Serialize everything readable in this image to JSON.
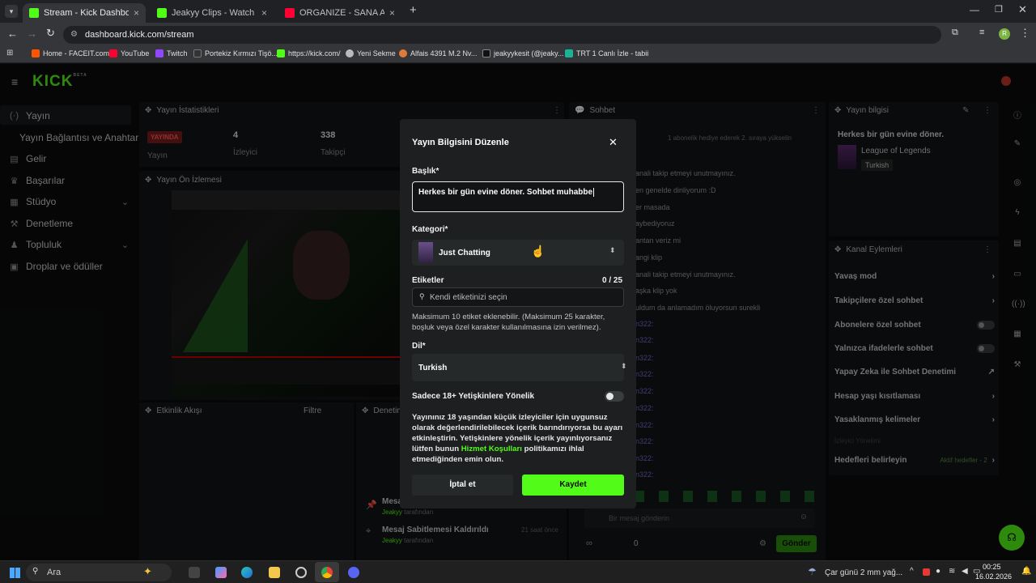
{
  "browser": {
    "tabs": [
      {
        "title": "Stream - Kick Dashboard",
        "active": true
      },
      {
        "title": "Jeakyy Clips - Watch Live on Kick",
        "active": false
      },
      {
        "title": "ORGANIZE - SANA ANLATMA",
        "active": false
      }
    ],
    "url": "dashboard.kick.com/stream",
    "profile_initial": "R",
    "bookmarks": [
      "Home - FACEIT.com",
      "YouTube",
      "Twitch",
      "Portekiz Kırmızı Tişö...",
      "https://kick.com/",
      "Yeni Sekme",
      "Alfais 4391 M.2 Nv...",
      "jeakyykesit (@jeaky...",
      "TRT 1 Canlı İzle - tabii"
    ]
  },
  "app": {
    "logo": "KICK",
    "logo_badge": "BETA",
    "sidebar": [
      {
        "icon": "broadcast-icon",
        "glyph": "((·))",
        "label": "Yayın"
      },
      {
        "icon": "",
        "glyph": "",
        "label": "Yayın Bağlantısı ve Anahtarı"
      },
      {
        "icon": "income-icon",
        "glyph": "▤",
        "label": "Gelir"
      },
      {
        "icon": "trophy-icon",
        "glyph": "♛",
        "label": "Başarılar"
      },
      {
        "icon": "studio-icon",
        "glyph": "▦",
        "label": "Stüdyo"
      },
      {
        "icon": "wrench-icon",
        "glyph": "⚒",
        "label": "Denetleme"
      },
      {
        "icon": "community-icon",
        "glyph": "♟",
        "label": "Topluluk"
      },
      {
        "icon": "drops-icon",
        "glyph": "▣",
        "label": "Droplar ve ödüller"
      }
    ],
    "stats": {
      "title": "Yayın İstatistikleri",
      "live_badge": "YAYINDA",
      "live_label": "Yayın",
      "viewers": "4",
      "viewers_label": "İzleyici",
      "followers": "338",
      "followers_label": "Takipçi"
    },
    "preview": {
      "title": "Yayın Ön İzlemesi"
    },
    "activity": {
      "title": "Etkinlik Akışı",
      "filter": "Filtre"
    },
    "moderation": {
      "title": "Denetim",
      "items": [
        {
          "title": "Mesaj Sabitlemesi Kaldırıldı",
          "by": "Jeakyy",
          "by_suffix": "tarafından",
          "time": "21 saat önce"
        },
        {
          "title": "Mesaj",
          "by": "Jeakyy",
          "by_suffix": "tarafından",
          "time": ""
        }
      ]
    },
    "chat": {
      "title": "Sohbet",
      "banner": "1 abonelik hediye ederek 2. sıraya yükselin",
      "lines": [
        "anali takip etmeyi unutmayınız.",
        "en genelde dinliyorum :D",
        "er masada",
        "aybediyoruz",
        "antan veriz mi",
        "angi klip",
        "anali takip etmeyi unutmayınız.",
        "aşka klip yok",
        "uldum da anlamadım öluyorsun surekli"
      ],
      "user_fragment": "n322:",
      "input_placeholder": "Bir mesaj gönderin",
      "send": "Gönder",
      "count": "0"
    },
    "stream_info": {
      "title": "Yayın bilgisi",
      "stream_title": "Herkes bir gün evine döner.",
      "category": "League of Legends",
      "language": "Turkish"
    },
    "channel_actions": {
      "title": "Kanal Eylemleri",
      "items": [
        {
          "label": "Yavaş mod",
          "control": "chevron"
        },
        {
          "label": "Takipçilere özel sohbet",
          "control": "chevron"
        },
        {
          "label": "Abonelere özel sohbet",
          "control": "toggle"
        },
        {
          "label": "Yalnızca ifadelerle sohbet",
          "control": "toggle"
        },
        {
          "label": "Yapay Zeka ile Sohbet Denetimi",
          "control": "external"
        },
        {
          "label": "Hesap yaşı kısıtlaması",
          "control": "chevron"
        },
        {
          "label": "Yasaklanmış kelimeler",
          "control": "chevron"
        }
      ],
      "viewer_mode": "İzleyici Yönelimi",
      "goals": "Hedefleri belirleyin",
      "goals_status": "Aktif hedefler - 2"
    }
  },
  "modal": {
    "title": "Yayın Bilgisini Düzenle",
    "title_label": "Başlık*",
    "title_value": "Herkes bir gün evine döner. Sohbet muhabbe",
    "category_label": "Kategori*",
    "category_value": "Just Chatting",
    "tags_label": "Etiketler",
    "tags_count": "0 / 25",
    "tags_placeholder": "Kendi etiketinizi seçin",
    "tags_help": "Maksimum 10 etiket eklenebilir. (Maksimum 25 karakter, boşluk veya özel karakter kullanılmasına izin verilmez).",
    "language_label": "Dil*",
    "language_value": "Turkish",
    "adult_label": "Sadece 18+ Yetişkinlere Yönelik",
    "adult_help_1": "Yayınınız 18 yaşından küçük izleyiciler için uygunsuz olarak değerlendirilebilecek içerik barındırıyorsa bu ayarı etkinleştirin. Yetişkinlere yönelik içerik yayınlıyorsanız lütfen bunun",
    "adult_link": "Hizmet Koşulları",
    "adult_help_2": "politikamızı ihlal etmediğinden emin olun.",
    "cancel": "İptal et",
    "save": "Kaydet"
  },
  "taskbar": {
    "search": "Ara",
    "weather": "Çar günü 2 mm yağ...",
    "time": "00:25",
    "date": "16.02.2026"
  },
  "colors": {
    "accent": "#53fc18",
    "bg": "#0b0c0d",
    "modal": "#1d1f20",
    "field": "#26292a"
  }
}
